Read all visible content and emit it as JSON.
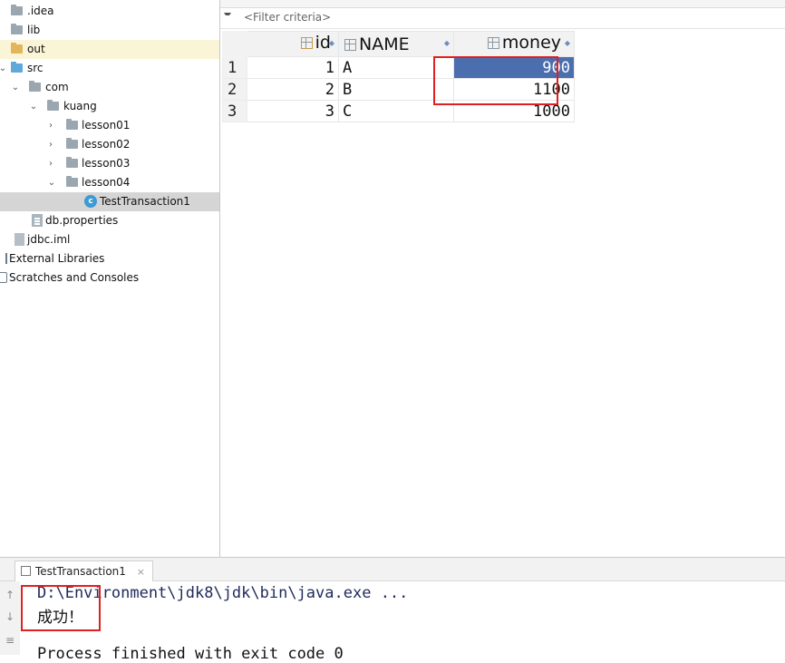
{
  "project_tree": {
    "items": [
      {
        "label": ".idea",
        "kind": "folder"
      },
      {
        "label": "lib",
        "kind": "folder"
      },
      {
        "label": "out",
        "kind": "folder-out"
      },
      {
        "label": "src",
        "kind": "folder-src"
      },
      {
        "label": "com",
        "kind": "package"
      },
      {
        "label": "kuang",
        "kind": "package"
      },
      {
        "label": "lesson01",
        "kind": "package"
      },
      {
        "label": "lesson02",
        "kind": "package"
      },
      {
        "label": "lesson03",
        "kind": "package"
      },
      {
        "label": "lesson04",
        "kind": "package"
      },
      {
        "label": "TestTransaction1",
        "kind": "java-class",
        "selected": true
      },
      {
        "label": "db.properties",
        "kind": "properties-file"
      },
      {
        "label": "jdbc.iml",
        "kind": "iml-file"
      },
      {
        "label": "External Libraries",
        "kind": "libraries"
      },
      {
        "label": "Scratches and Consoles",
        "kind": "consoles"
      }
    ]
  },
  "grid": {
    "filter_placeholder": "<Filter criteria>",
    "columns": [
      "id",
      "NAME",
      "money"
    ],
    "rows": [
      {
        "row_number": "1",
        "id": "1",
        "name": "A",
        "money": "900"
      },
      {
        "row_number": "2",
        "id": "2",
        "name": "B",
        "money": "1100"
      },
      {
        "row_number": "3",
        "id": "3",
        "name": "C",
        "money": "1000"
      }
    ],
    "selected_cell": "money row 1"
  },
  "run_panel": {
    "tab_label": "TestTransaction1",
    "close_glyph": "×",
    "command_line": "D:\\Environment\\jdk8\\jdk\\bin\\java.exe ...",
    "output": "成功！",
    "exit_line": "Process finished with exit code 0"
  },
  "icons": {
    "tree_expand": "chevron-right-icon",
    "tree_collapse": "chevron-down-icon",
    "filter": "filter-icon",
    "column": "table-column-icon",
    "primary_key": "key-column-icon",
    "sort": "sort-icon"
  },
  "colors": {
    "selection_blue": "#4b6eaf",
    "highlight_red": "#e02020",
    "tree_selected": "#d5d5d5",
    "out_folder_highlight": "#faf5d6"
  }
}
